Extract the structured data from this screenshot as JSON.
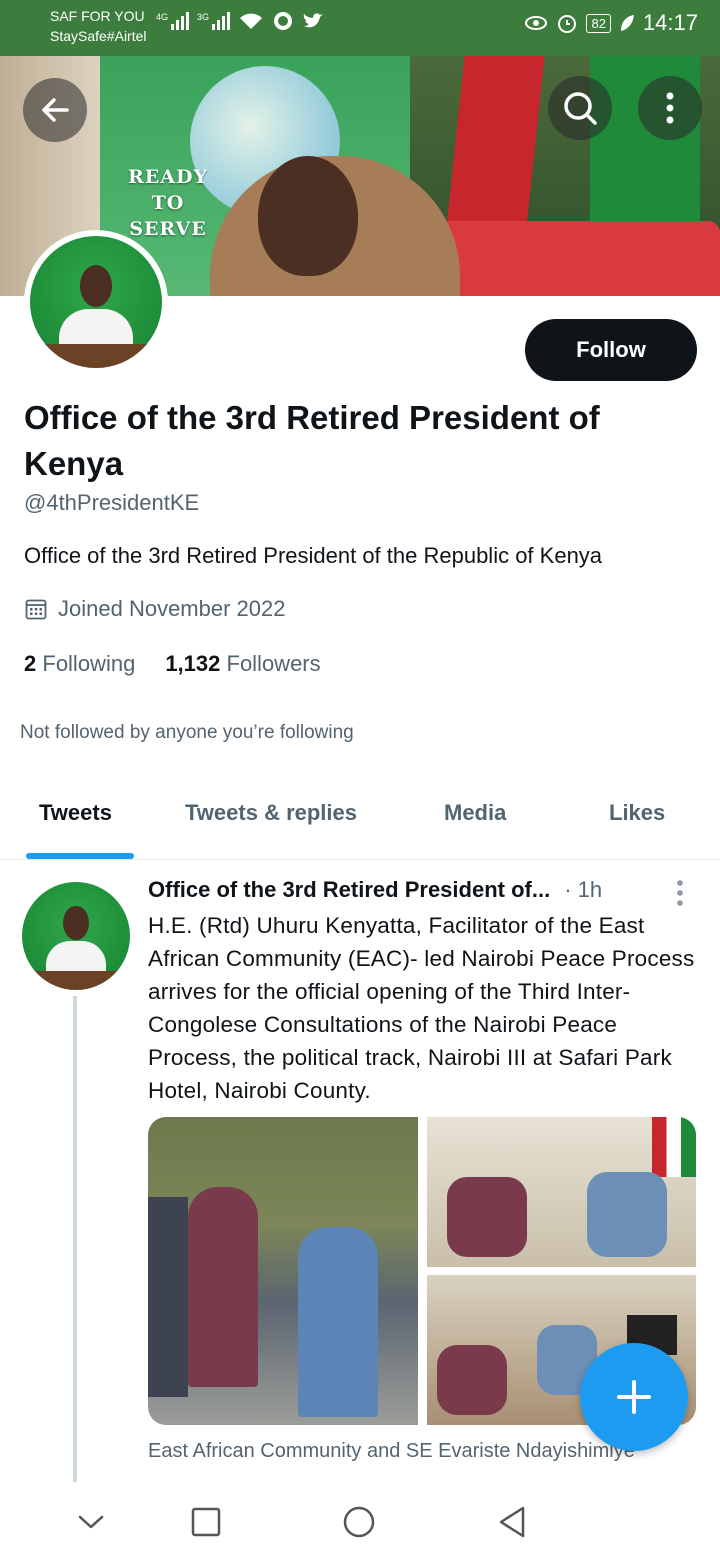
{
  "status_bar": {
    "carrier_line1": "SAF FOR YOU",
    "carrier_line2": "StaySafe#Airtel",
    "signal1_label": "4G",
    "signal2_label": "3G",
    "battery": "82",
    "time": "14:17"
  },
  "banner": {
    "text_lines": [
      "READY",
      "TO",
      "SERVE"
    ]
  },
  "profile": {
    "follow_label": "Follow",
    "name": "Office of the 3rd Retired President of Kenya",
    "handle": "@4thPresidentKE",
    "bio": "Office of the 3rd Retired President of the Republic of Kenya",
    "joined": "Joined November 2022",
    "following_count": "2",
    "following_label": "Following",
    "followers_count": "1,132",
    "followers_label": "Followers",
    "not_followed": "Not followed by anyone you’re following"
  },
  "tabs": [
    {
      "label": "Tweets",
      "active": true
    },
    {
      "label": "Tweets & replies",
      "active": false
    },
    {
      "label": "Media",
      "active": false
    },
    {
      "label": "Likes",
      "active": false
    }
  ],
  "tweet": {
    "author": "Office of the 3rd Retired President of...",
    "time": "· 1h",
    "text": "H.E. (Rtd) Uhuru Kenyatta, Facilitator of the East African Community (EAC)- led Nairobi Peace Process arrives for the official opening of the Third Inter-Congolese Consultations of the Nairobi Peace Process, the political track, Nairobi III at Safari Park Hotel, Nairobi County.",
    "caption": "East African Community and SE Evariste Ndayishimiye"
  },
  "colors": {
    "status_bar": "#3c7d3e",
    "accent": "#1d9bf0",
    "follow_button": "#0f1419",
    "secondary_text": "#536471"
  },
  "icons": [
    "back-arrow-icon",
    "search-icon",
    "more-vertical-icon",
    "calendar-icon",
    "compose-plus-icon",
    "nav-down-icon",
    "nav-recents-icon",
    "nav-home-icon",
    "nav-back-icon"
  ]
}
